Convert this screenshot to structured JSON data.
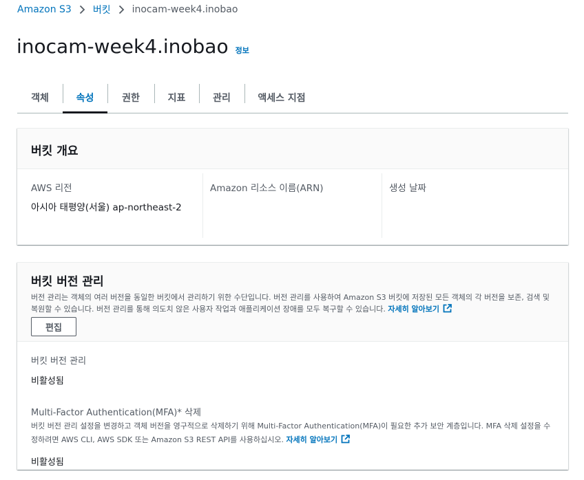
{
  "breadcrumb": {
    "items": [
      "Amazon S3",
      "버킷"
    ],
    "current": "inocam-week4.inobao"
  },
  "page": {
    "title": "inocam-week4.inobao",
    "info_link": "정보"
  },
  "tabs": [
    {
      "label": "객체",
      "active": false
    },
    {
      "label": "속성",
      "active": true
    },
    {
      "label": "권한",
      "active": false
    },
    {
      "label": "지표",
      "active": false
    },
    {
      "label": "관리",
      "active": false
    },
    {
      "label": "액세스 지점",
      "active": false
    }
  ],
  "overview": {
    "title": "버킷 개요",
    "region_label": "AWS 리전",
    "region_value": "아시아 태평양(서울) ap-northeast-2",
    "arn_label": "Amazon 리소스 이름(ARN)",
    "created_label": "생성 날짜"
  },
  "versioning": {
    "title": "버킷 버전 관리",
    "description": "버전 관리는 객체의 여러 버전을 동일한 버킷에서 관리하기 위한 수단입니다. 버전 관리를 사용하여 Amazon S3 버킷에 저장된 모든 객체의 각 버전을 보존, 검색 및 복원할 수 있습니다. 버전 관리를 통해 의도치 않은 사용자 작업과 애플리케이션 장애를 모두 복구할 수 있습니다.",
    "learn_more": "자세히 알아보기",
    "edit_label": "편집",
    "status_label": "버킷 버전 관리",
    "status_value": "비활성됨",
    "mfa_label": "Multi-Factor Authentication(MFA)* 삭제",
    "mfa_description": "버킷 버전 관리 설정을 변경하고 객체 버전을 영구적으로 삭제하기 위해 Multi-Factor Authentication(MFA)이 필요한 추가 보안 계층입니다. MFA 삭제 설정을 수정하려면 AWS CLI, AWS SDK 또는 Amazon S3 REST API를 사용하십시오.",
    "mfa_learn_more": "자세히 알아보기",
    "mfa_value": "비활성됨"
  },
  "colors": {
    "link": "#0073bb",
    "text": "#16191f",
    "secondary_text": "#545b64",
    "header_bg": "#fafafa"
  },
  "icons": {
    "breadcrumb_separator": "chevron-right-icon",
    "external_link": "external-link-icon"
  }
}
